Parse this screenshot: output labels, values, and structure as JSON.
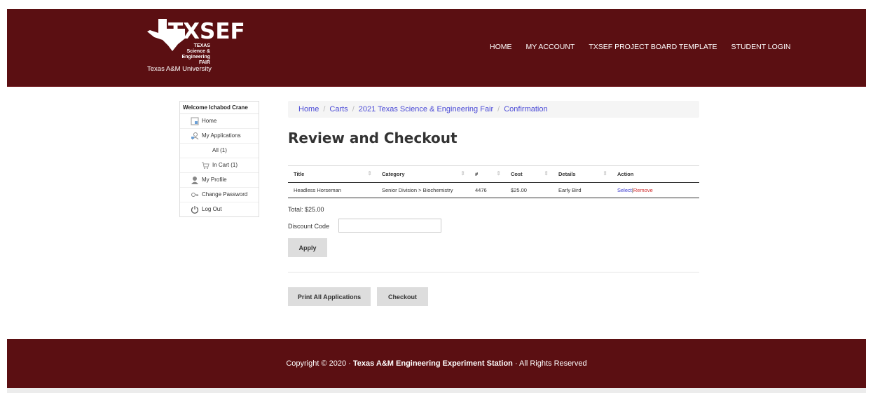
{
  "header": {
    "logo_main": "TXSEF",
    "logo_sub_line1": "TEXAS Science &",
    "logo_sub_line2": "Engineering FAIR",
    "university": "Texas A&M University",
    "nav": [
      "HOME",
      "MY ACCOUNT",
      "TXSEF PROJECT BOARD TEMPLATE",
      "STUDENT LOGIN"
    ]
  },
  "sidebar": {
    "welcome": "Welcome Ichabod Crane",
    "items": [
      {
        "label": "Home",
        "icon": "home-icon"
      },
      {
        "label": "My Applications",
        "icon": "applications-icon"
      },
      {
        "label": "All (1)",
        "icon": ""
      },
      {
        "label": "In Cart (1)",
        "icon": "cart-icon"
      },
      {
        "label": "My Profile",
        "icon": "user-icon"
      },
      {
        "label": "Change Password",
        "icon": "key-icon"
      },
      {
        "label": "Log Out",
        "icon": "power-icon"
      }
    ]
  },
  "breadcrumb": [
    "Home",
    "Carts",
    "2021 Texas Science & Engineering Fair",
    "Confirmation"
  ],
  "page_title": "Review and Checkout",
  "table": {
    "headers": [
      "Title",
      "Category",
      "#",
      "Cost",
      "Details",
      "Action"
    ],
    "rows": [
      {
        "title": "Headless Horseman",
        "category": "Senior Division > Biochemistry",
        "number": "4476",
        "cost": "$25.00",
        "details": "Early Bird",
        "action_select": "Select",
        "action_separator": "|",
        "action_remove": "Remove"
      }
    ]
  },
  "total": "Total: $25.00",
  "discount": {
    "label": "Discount Code",
    "value": ""
  },
  "buttons": {
    "apply": "Apply",
    "print_all": "Print All Applications",
    "checkout": "Checkout"
  },
  "footer": {
    "prefix": "Copyright © 2020 · ",
    "org": "Texas A&M Engineering Experiment Station",
    "suffix": " · All Rights Reserved"
  },
  "colors": {
    "brand": "#5b0f12",
    "link": "#4a4ad6",
    "remove": "#d02a2a"
  }
}
